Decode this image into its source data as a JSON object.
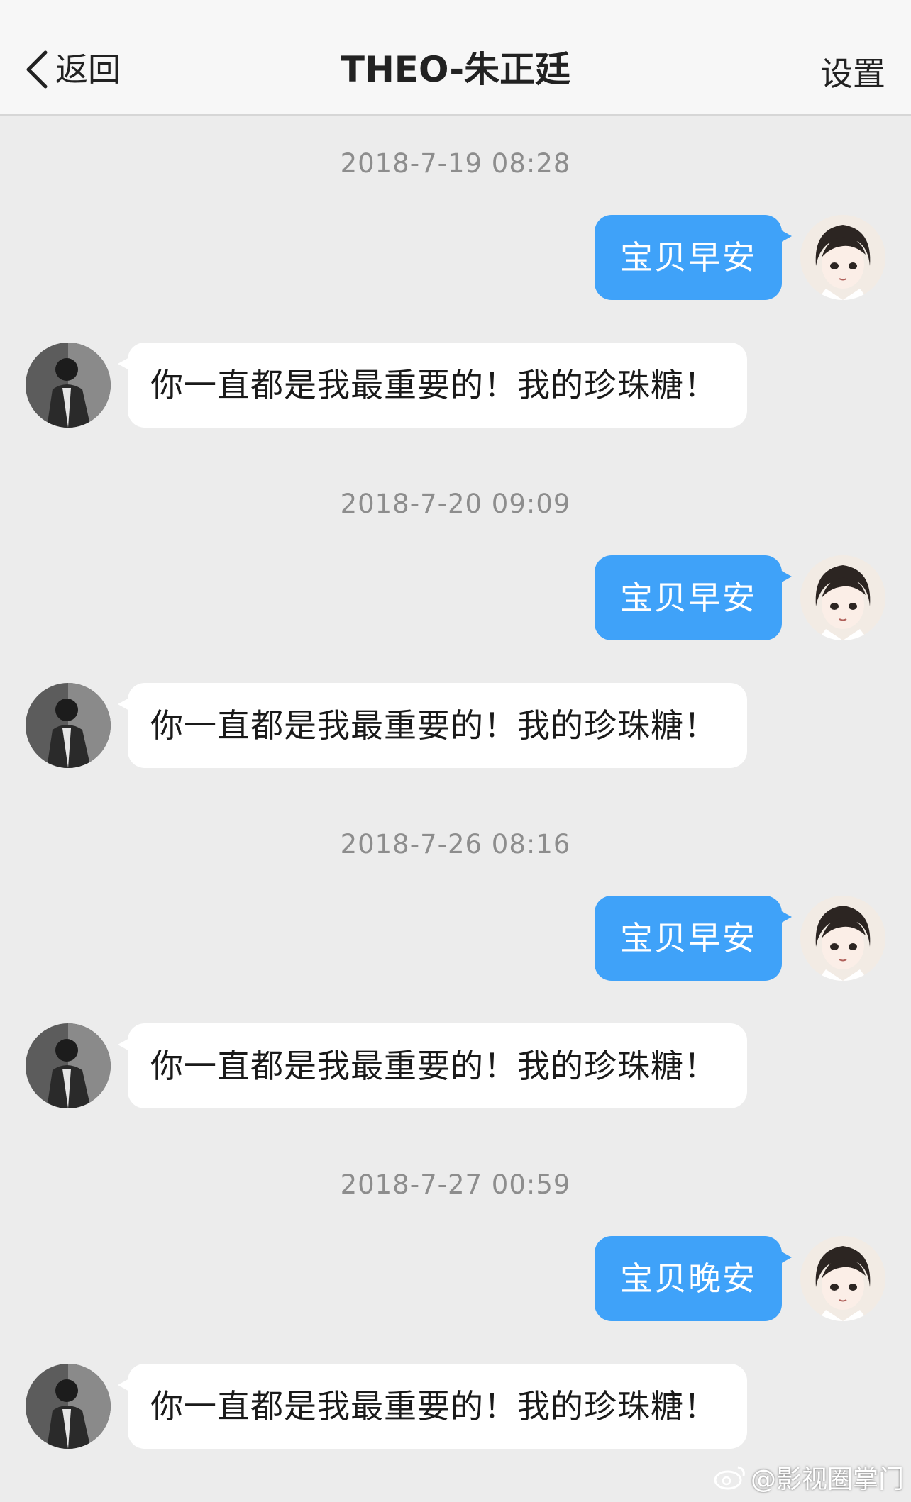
{
  "nav": {
    "back_label": "返回",
    "title": "THEO-朱正廷",
    "settings_label": "设置"
  },
  "messages": [
    {
      "timestamp": "2018-7-19 08:28",
      "sent": "宝贝早安",
      "received": "你一直都是我最重要的！我的珍珠糖！"
    },
    {
      "timestamp": "2018-7-20 09:09",
      "sent": "宝贝早安",
      "received": "你一直都是我最重要的！我的珍珠糖！"
    },
    {
      "timestamp": "2018-7-26 08:16",
      "sent": "宝贝早安",
      "received": "你一直都是我最重要的！我的珍珠糖！"
    },
    {
      "timestamp": "2018-7-27 00:59",
      "sent": "宝贝晚安",
      "received": "你一直都是我最重要的！我的珍珠糖！"
    }
  ],
  "watermark": {
    "text": "@影视圈掌门"
  },
  "colors": {
    "sent_bubble": "#3fa2f9",
    "received_bubble": "#ffffff",
    "background": "#ececec",
    "timestamp": "#8d8d8d"
  },
  "icons": {
    "back": "chevron-left-icon",
    "self_avatar": "cartoon-avatar-icon",
    "contact_avatar": "photo-avatar-icon",
    "watermark": "weibo-logo-icon"
  }
}
